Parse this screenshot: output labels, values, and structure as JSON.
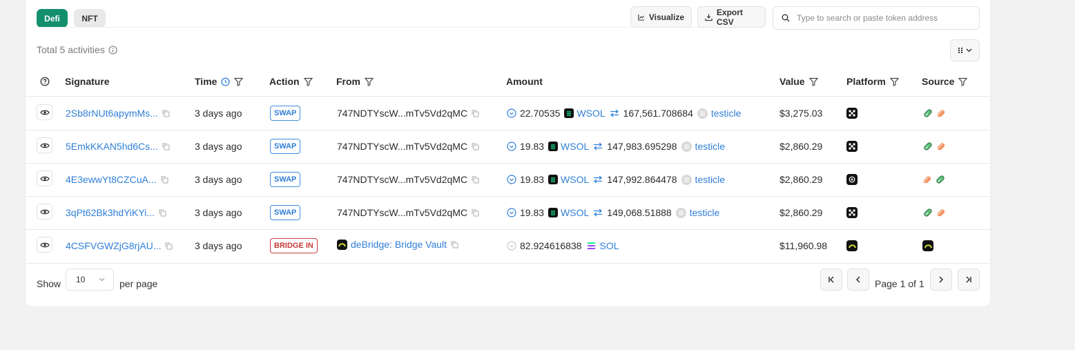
{
  "tabs": {
    "defi": "Defi",
    "nft": "NFT"
  },
  "toolbar": {
    "visualize": "Visualize",
    "export_csv": "Export CSV",
    "search_placeholder": "Type to search or paste token address"
  },
  "summary": {
    "total": "Total 5 activities"
  },
  "columns": {
    "signature": "Signature",
    "time": "Time",
    "action": "Action",
    "from": "From",
    "amount": "Amount",
    "value": "Value",
    "platform": "Platform",
    "source": "Source"
  },
  "rows": [
    {
      "signature": "2Sb8rNUt6apymMs...",
      "time": "3 days ago",
      "action": "SWAP",
      "from": "747NDTYscW...mTv5Vd2qMC",
      "amount_in": "22.70535",
      "token_in": "WSOL",
      "amount_out": "167,561.708684",
      "token_out": "testicle",
      "value": "$3,275.03"
    },
    {
      "signature": "5EmkKKAN5hd6Cs...",
      "time": "3 days ago",
      "action": "SWAP",
      "from": "747NDTYscW...mTv5Vd2qMC",
      "amount_in": "19.83",
      "token_in": "WSOL",
      "amount_out": "147,983.695298",
      "token_out": "testicle",
      "value": "$2,860.29"
    },
    {
      "signature": "4E3ewwYt8CZCuA...",
      "time": "3 days ago",
      "action": "SWAP",
      "from": "747NDTYscW...mTv5Vd2qMC",
      "amount_in": "19.83",
      "token_in": "WSOL",
      "amount_out": "147,992.864478",
      "token_out": "testicle",
      "value": "$2,860.29"
    },
    {
      "signature": "3qPt62Bk3hdYiKYi...",
      "time": "3 days ago",
      "action": "SWAP",
      "from": "747NDTYscW...mTv5Vd2qMC",
      "amount_in": "19.83",
      "token_in": "WSOL",
      "amount_out": "149,068.51888",
      "token_out": "testicle",
      "value": "$2,860.29"
    },
    {
      "signature": "4CSFVGWZjG8rjAU...",
      "time": "3 days ago",
      "action": "BRIDGE IN",
      "from": "deBridge: Bridge Vault",
      "amount_in": "82.924616838",
      "token_in": "SOL",
      "value": "$11,960.98"
    }
  ],
  "pagination": {
    "show": "Show",
    "per_page_value": "10",
    "per_page": "per page",
    "page_info": "Page 1 of 1"
  },
  "colors": {
    "accent": "#148f6d",
    "link": "#2f7fd6",
    "bridge": "#c63a3a"
  }
}
